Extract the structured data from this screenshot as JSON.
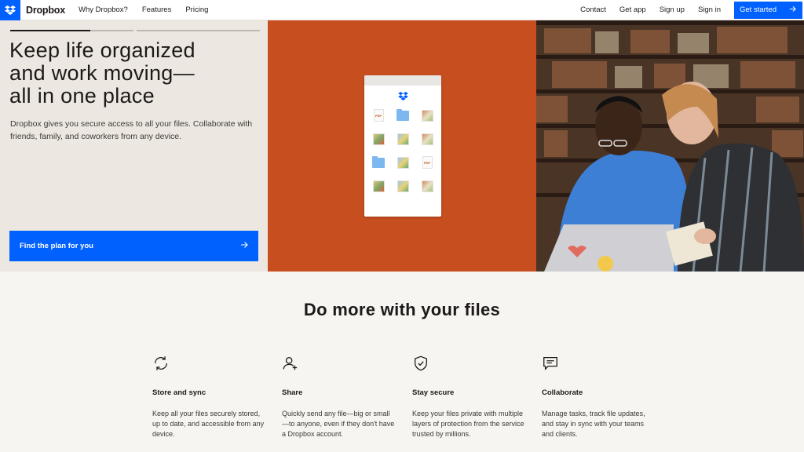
{
  "nav": {
    "brand": "Dropbox",
    "left_links": [
      "Why Dropbox?",
      "Features",
      "Pricing"
    ],
    "right_links": [
      "Contact",
      "Get app",
      "Sign up",
      "Sign in"
    ],
    "cta_label": "Get started",
    "accent": "#0061fe"
  },
  "hero": {
    "slide_progress": [
      0.65,
      0
    ],
    "headline": [
      "Keep life organized",
      "and work moving—",
      "all in one place"
    ],
    "subtext": "Dropbox gives you secure access to all your files. Collaborate with friends, family, and coworkers from any device.",
    "cta_label": "Find the plan for you",
    "mid_color": "#c64e1f",
    "file_icons": [
      "pdf-file",
      "folder",
      "photo",
      "photo",
      "photo",
      "photo",
      "folder",
      "photo",
      "pdf-file",
      "photo",
      "photo",
      "photo"
    ],
    "pdf_text": "PDF"
  },
  "features": {
    "title": "Do more with your files",
    "items": [
      {
        "icon": "sync-icon",
        "title": "Store and sync",
        "text": "Keep all your files securely stored, up to date, and accessible from any device."
      },
      {
        "icon": "add-user-icon",
        "title": "Share",
        "text": "Quickly send any file—big or small—to anyone, even if they don't have a Dropbox account."
      },
      {
        "icon": "shield-check-icon",
        "title": "Stay secure",
        "text": "Keep your files private with multiple layers of protection from the service trusted by millions."
      },
      {
        "icon": "chat-icon",
        "title": "Collaborate",
        "text": "Manage tasks, track file updates, and stay in sync with your teams and clients."
      }
    ]
  }
}
